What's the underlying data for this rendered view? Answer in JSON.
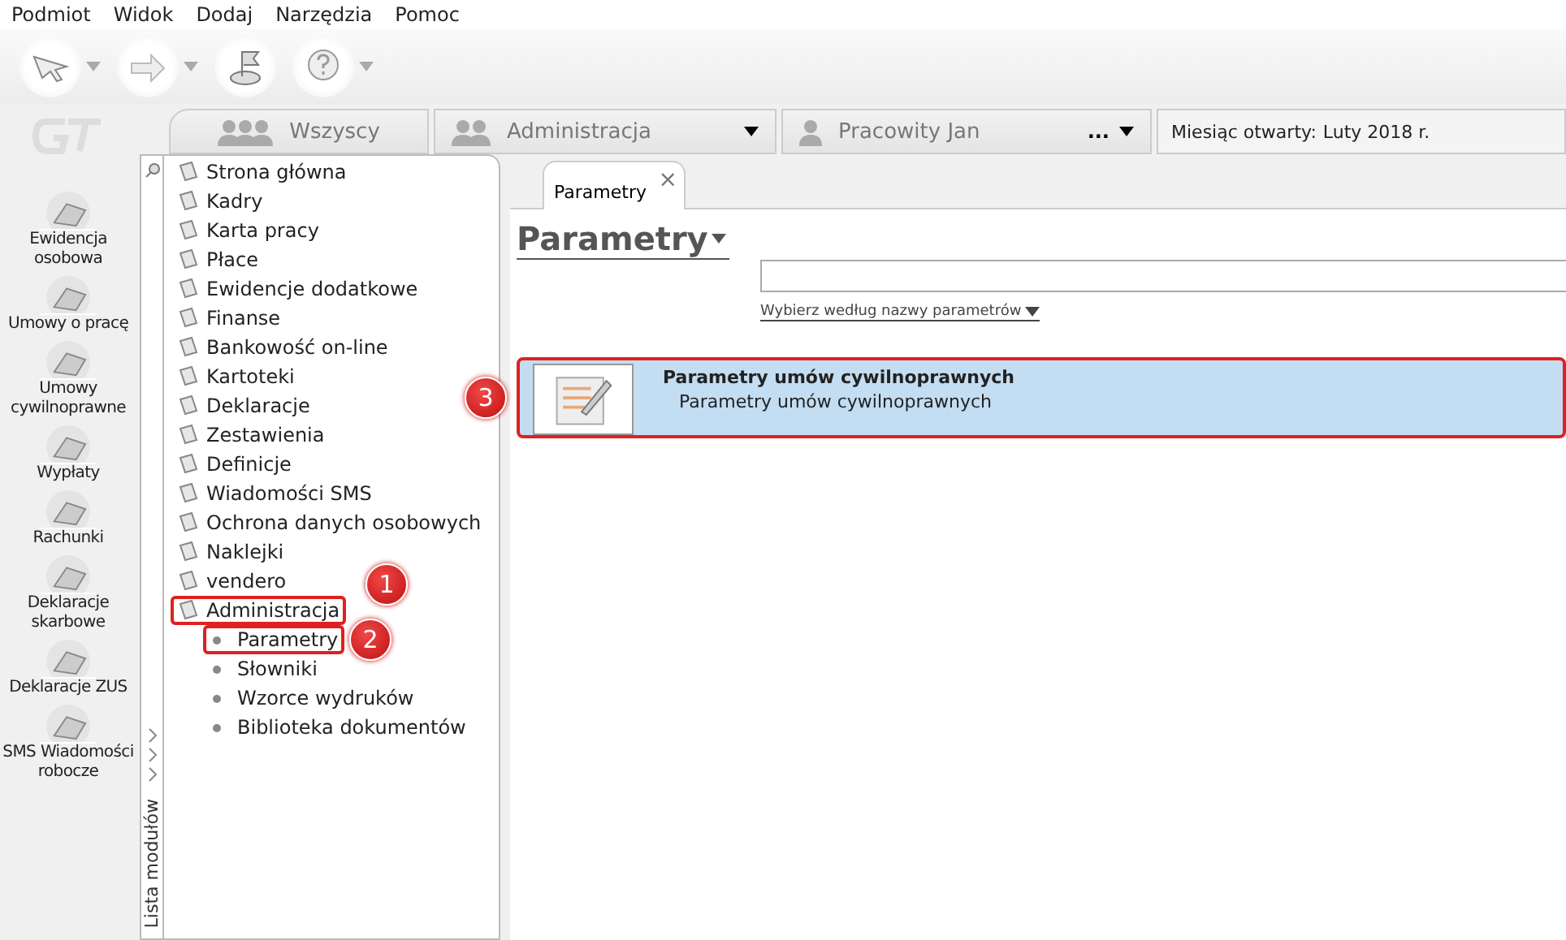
{
  "menu_bar": [
    "Podmiot",
    "Widok",
    "Dodaj",
    "Narzędzia",
    "Pomoc"
  ],
  "toolbar": [
    {
      "kind": "arrow",
      "dropdown": true
    },
    {
      "kind": "forward",
      "dropdown": true
    },
    {
      "kind": "flag",
      "dropdown": false
    },
    {
      "kind": "help",
      "dropdown": true
    }
  ],
  "side_modules": [
    {
      "label": "Ewidencja osobowa"
    },
    {
      "label": "Umowy o pracę"
    },
    {
      "label": "Umowy cywilnoprawne"
    },
    {
      "label": "Wypłaty"
    },
    {
      "label": "Rachunki"
    },
    {
      "label": "Deklaracje skarbowe"
    },
    {
      "label": "Deklaracje ZUS"
    },
    {
      "label": "SMS Wiadomości robocze"
    }
  ],
  "context_bar": {
    "tabs": [
      {
        "label": "Wszyscy",
        "dropdown": false
      },
      {
        "label": "Administracja",
        "dropdown": true
      },
      {
        "label": "Pracowity Jan",
        "more": "...",
        "dropdown": true
      }
    ],
    "month_label": "Miesiąc otwarty:",
    "month_value": "Luty 2018 r."
  },
  "module_panel": {
    "side_label": "Lista modułów",
    "items": [
      {
        "label": "Strona główna"
      },
      {
        "label": "Kadry"
      },
      {
        "label": "Karta pracy"
      },
      {
        "label": "Płace"
      },
      {
        "label": "Ewidencje dodatkowe"
      },
      {
        "label": "Finanse"
      },
      {
        "label": "Bankowość on-line"
      },
      {
        "label": "Kartoteki"
      },
      {
        "label": "Deklaracje"
      },
      {
        "label": "Zestawienia"
      },
      {
        "label": "Definicje"
      },
      {
        "label": "Wiadomości SMS"
      },
      {
        "label": "Ochrona danych osobowych"
      },
      {
        "label": "Naklejki"
      },
      {
        "label": "vendero"
      },
      {
        "label": "Administracja",
        "highlighted": true,
        "callout": "1",
        "children": [
          {
            "label": "Parametry",
            "highlighted": true,
            "callout": "2"
          },
          {
            "label": "Słowniki",
            "highlighted": false
          },
          {
            "label": "Wzorce wydruków",
            "highlighted": false
          },
          {
            "label": "Biblioteka dokumentów",
            "highlighted": false
          }
        ]
      }
    ]
  },
  "content": {
    "tabs": [
      {
        "label": "Parametry",
        "selected": true,
        "close": "×"
      }
    ],
    "heading": "Parametry",
    "filter_link": "Wybierz według nazwy parametrów",
    "results": [
      {
        "title": "Parametry umów cywilnoprawnych",
        "subtitle": "Parametry umów cywilnoprawnych",
        "selected": true,
        "highlighted": true,
        "callout": "3"
      }
    ]
  }
}
